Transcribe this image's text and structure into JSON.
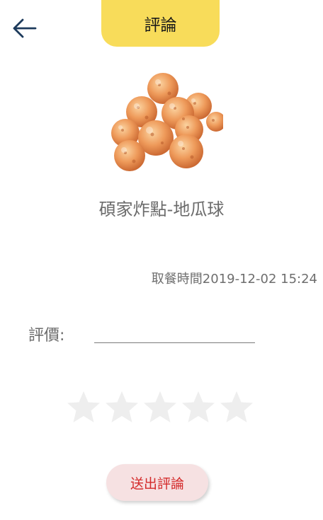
{
  "header": {
    "title": "評論",
    "back_icon": "arrow-left-icon",
    "tab_color": "#f8dc5a"
  },
  "product": {
    "image_icon": "fried-sweet-potato-balls-image",
    "name": "碩家炸點-地瓜球"
  },
  "order": {
    "pickup_time": "取餐時間2019-12-02 15:24"
  },
  "review": {
    "label": "評價:",
    "input_value": "",
    "rating_value": 0,
    "rating_max": 5,
    "star_color": "#eeeeee"
  },
  "actions": {
    "submit_label": "送出評論",
    "submit_color": "#d42b2b"
  }
}
